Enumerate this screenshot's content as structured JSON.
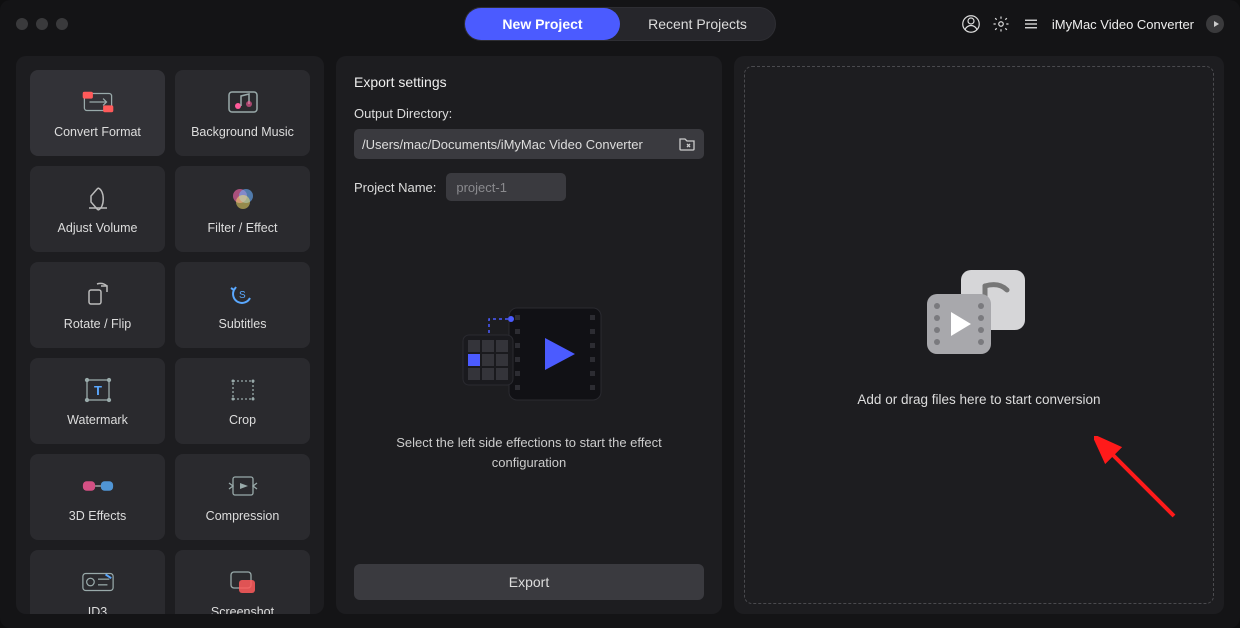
{
  "titlebar": {
    "tabs": {
      "new": "New Project",
      "recent": "Recent Projects"
    },
    "app_name": "iMyMac Video Converter"
  },
  "tools": [
    {
      "id": "convert-format",
      "label": "Convert Format"
    },
    {
      "id": "background-music",
      "label": "Background Music"
    },
    {
      "id": "adjust-volume",
      "label": "Adjust Volume"
    },
    {
      "id": "filter-effect",
      "label": "Filter / Effect"
    },
    {
      "id": "rotate-flip",
      "label": "Rotate / Flip"
    },
    {
      "id": "subtitles",
      "label": "Subtitles"
    },
    {
      "id": "watermark",
      "label": "Watermark"
    },
    {
      "id": "crop",
      "label": "Crop"
    },
    {
      "id": "3d-effects",
      "label": "3D Effects"
    },
    {
      "id": "compression",
      "label": "Compression"
    },
    {
      "id": "id3",
      "label": "ID3"
    },
    {
      "id": "screenshot",
      "label": "Screenshot"
    }
  ],
  "export": {
    "heading": "Export settings",
    "dir_label": "Output Directory:",
    "dir_value": "/Users/mac/Documents/iMyMac Video Converter",
    "name_label": "Project Name:",
    "name_placeholder": "project-1",
    "hint": "Select the left side effections to start the effect configuration",
    "button": "Export"
  },
  "drop": {
    "text": "Add or drag files here to start conversion"
  }
}
